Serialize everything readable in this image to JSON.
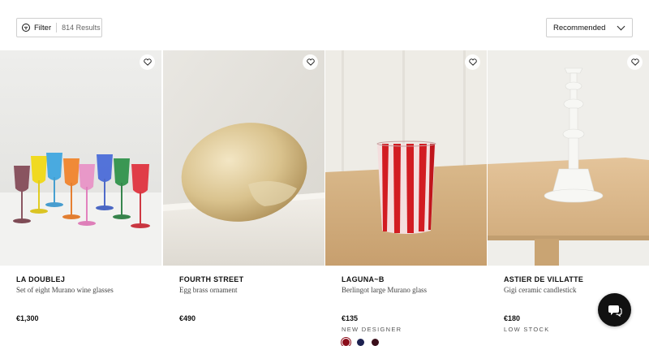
{
  "toolbar": {
    "filter_label": "Filter",
    "results_count": "814 Results",
    "sort_value": "Recommended"
  },
  "products": [
    {
      "brand": "LA DOUBLEJ",
      "name": "Set of eight Murano wine glasses",
      "price": "€1,300",
      "tag": ""
    },
    {
      "brand": "FOURTH STREET",
      "name": "Egg brass ornament",
      "price": "€490",
      "tag": ""
    },
    {
      "brand": "LAGUNA~B",
      "name": "Berlingot large Murano glass",
      "price": "€135",
      "tag": "NEW DESIGNER",
      "swatches": [
        "#8b0d1a",
        "#1d2150",
        "#3a0e1a"
      ]
    },
    {
      "brand": "ASTIER DE VILLATTE",
      "name": "Gigi ceramic candlestick",
      "price": "€180",
      "tag": "LOW STOCK"
    }
  ],
  "icons": {
    "filter": "filter-icon",
    "sort": "chevron-down-icon",
    "wishlist": "heart-icon",
    "chat": "chat-bubble-icon"
  }
}
